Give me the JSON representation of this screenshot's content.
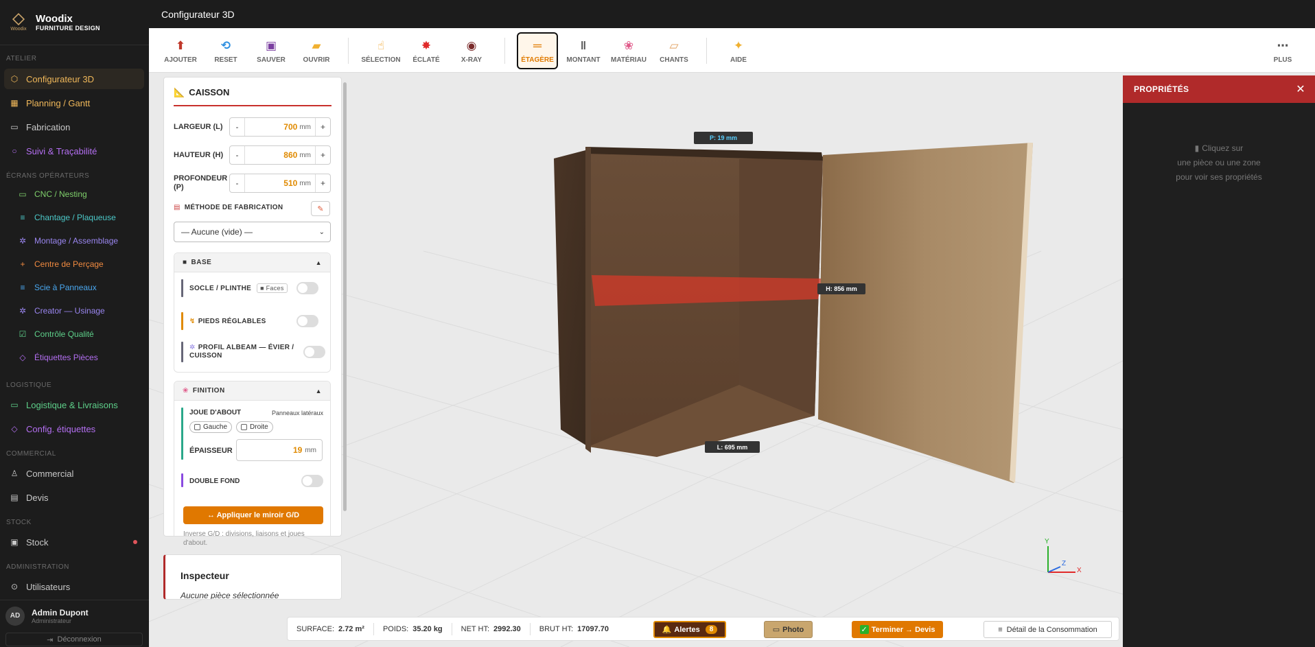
{
  "app": {
    "brand": "Woodix",
    "brand_sub": "FURNITURE DESIGN",
    "logo_mini": "Woodix",
    "page_title": "Configurateur 3D"
  },
  "sidebar": {
    "sections": {
      "atelier": "ATELIER",
      "operateurs": "ÉCRANS OPÉRATEURS",
      "logistique": "LOGISTIQUE",
      "commercial": "COMMERCIAL",
      "stock": "STOCK",
      "admin": "ADMINISTRATION"
    },
    "items": [
      {
        "label": "Configurateur 3D",
        "color": "#f0b85a"
      },
      {
        "label": "Planning / Gantt",
        "color": "#f0b85a"
      },
      {
        "label": "Fabrication",
        "color": "#c9c9c9"
      },
      {
        "label": "Suivi & Traçabilité",
        "color": "#b46ff2"
      },
      {
        "label": "CNC / Nesting",
        "color": "#7fd06b"
      },
      {
        "label": "Chantage / Plaqueuse",
        "color": "#4cc9c9"
      },
      {
        "label": "Montage / Assemblage",
        "color": "#9a86f0"
      },
      {
        "label": "Centre de Perçage",
        "color": "#f08a40"
      },
      {
        "label": "Scie à Panneaux",
        "color": "#4aa8f0"
      },
      {
        "label": "Creator — Usinage",
        "color": "#9a86f0"
      },
      {
        "label": "Contrôle Qualité",
        "color": "#5ed08a"
      },
      {
        "label": "Étiquettes Pièces",
        "color": "#b46ff2"
      },
      {
        "label": "Logistique & Livraisons",
        "color": "#5ed08a"
      },
      {
        "label": "Config. étiquettes",
        "color": "#b46ff2"
      },
      {
        "label": "Commercial",
        "color": "#c9c9c9"
      },
      {
        "label": "Devis",
        "color": "#c9c9c9"
      },
      {
        "label": "Stock",
        "color": "#c9c9c9"
      },
      {
        "label": "Utilisateurs",
        "color": "#c9c9c9"
      }
    ],
    "user": {
      "initials": "AD",
      "name": "Admin Dupont",
      "role": "Administrateur"
    },
    "logout": "Déconnexion"
  },
  "toolbar": {
    "ajouter": "AJOUTER",
    "reset": "RESET",
    "sauver": "SAUVER",
    "ouvrir": "OUVRIR",
    "selection": "SÉLECTION",
    "eclate": "ÉCLATÉ",
    "xray": "X-RAY",
    "etagere": "ÉTAGÈRE",
    "montant": "MONTANT",
    "materiau": "MATÉRIAU",
    "chants": "CHANTS",
    "aide": "AIDE",
    "plus": "PLUS",
    "active": "ÉTAGÈRE"
  },
  "caisson": {
    "title": "CAISSON",
    "largeur_label": "LARGEUR (L)",
    "largeur": "700",
    "hauteur_label": "HAUTEUR (H)",
    "hauteur": "860",
    "profondeur_label": "PROFONDEUR (P)",
    "profondeur": "510",
    "unit": "mm",
    "minus": "-",
    "plus": "+",
    "methode_label": "MÉTHODE DE FABRICATION",
    "methode_value": "— Aucune (vide) —",
    "base": {
      "title": "BASE",
      "socle": "SOCLE / PLINTHE",
      "faces": "Faces",
      "pieds": "PIEDS RÉGLABLES",
      "profil": "PROFIL ALBEAM — ÉVIER / CUISSON"
    },
    "finition": {
      "title": "FINITION",
      "joue": "JOUE D'ABOUT",
      "panneaux": "Panneaux latéraux",
      "gauche": "Gauche",
      "droite": "Droite",
      "epaisseur_label": "ÉPAISSEUR",
      "epaisseur": "19",
      "double_fond": "DOUBLE FOND",
      "mirror_btn": "↔ Appliquer le miroir G/D",
      "mirror_note": "Inverse G/D : divisions, liaisons et joues d'about."
    }
  },
  "inspector": {
    "title": "Inspecteur",
    "empty": "Aucune pièce sélectionnée"
  },
  "viewport": {
    "dim_p": "P: 19 mm",
    "dim_h": "H: 856 mm",
    "dim_l": "L: 695 mm",
    "axis_x": "X",
    "axis_y": "Y",
    "axis_z": "Z"
  },
  "properties": {
    "title": "PROPRIÉTÉS",
    "empty_1": "Cliquez sur",
    "empty_2": "une pièce ou une zone",
    "empty_3": "pour voir ses propriétés"
  },
  "status": {
    "surface_label": "SURFACE:",
    "surface": "2.72 m²",
    "poids_label": "POIDS:",
    "poids": "35.20 kg",
    "net_label": "NET HT:",
    "net": "2992.30",
    "brut_label": "BRUT HT:",
    "brut": "17097.70",
    "alertes": "Alertes",
    "alertes_count": "8",
    "photo": "Photo",
    "terminer": "Terminer → Devis",
    "detail": "Détail de la Consommation"
  }
}
